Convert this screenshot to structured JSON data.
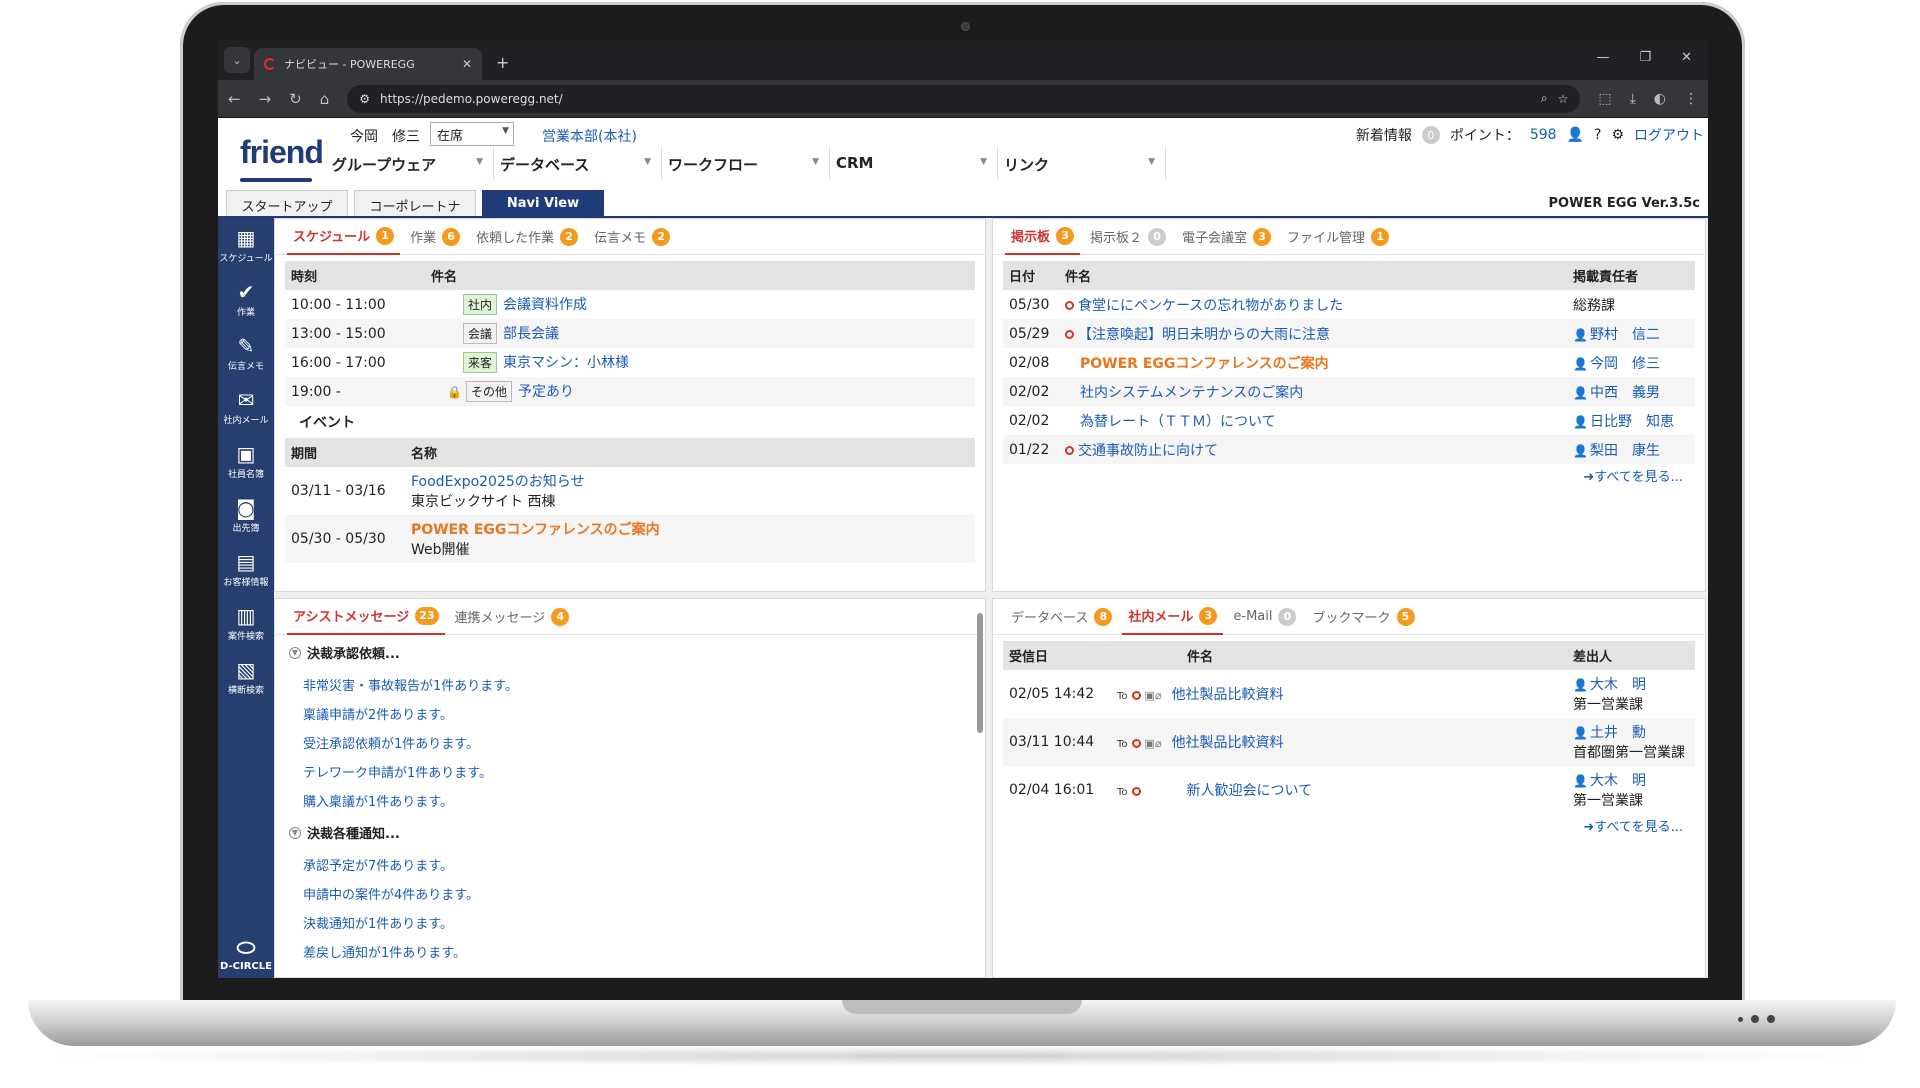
{
  "browser": {
    "tab_title": "ナビビュー - POWEREGG",
    "url": "https://pedemo.poweregg.net/"
  },
  "app": {
    "logo": "friend",
    "user": "今岡　修三",
    "status": "在席",
    "dept": "営業本部(本社)",
    "new_info_label": "新着情報",
    "new_info_count": "0",
    "points_label": "ポイント：",
    "points": "598",
    "logout": "ログアウト",
    "version": "POWER EGG Ver.3.5c",
    "menu": [
      "グループウェア",
      "データベース",
      "ワークフロー",
      "CRM",
      "リンク"
    ],
    "navtabs": [
      "スタートアップナビ",
      "コーポレートナビ",
      "Navi View"
    ]
  },
  "leftnav": [
    {
      "label": "スケジュール",
      "icon": "calendar-icon"
    },
    {
      "label": "作業",
      "icon": "check-icon"
    },
    {
      "label": "伝言メモ",
      "icon": "memo-icon"
    },
    {
      "label": "社内メール",
      "icon": "mail-icon"
    },
    {
      "label": "社員名簿",
      "icon": "person-icon"
    },
    {
      "label": "出先簿",
      "icon": "location-icon"
    },
    {
      "label": "お客様情報",
      "icon": "customer-icon"
    },
    {
      "label": "案件検索",
      "icon": "document-icon"
    },
    {
      "label": "横断検索",
      "icon": "cross-search-icon"
    }
  ],
  "leftnav_footer": "D-CIRCLE",
  "schedule": {
    "tabs": [
      {
        "label": "スケジュール",
        "count": "1"
      },
      {
        "label": "作業",
        "count": "6"
      },
      {
        "label": "依頼した作業",
        "count": "2"
      },
      {
        "label": "伝言メモ",
        "count": "2"
      }
    ],
    "headers": [
      "時刻",
      "件名"
    ],
    "rows": [
      {
        "time": "10:00 - 11:00",
        "cat": "社内",
        "title": "会議資料作成"
      },
      {
        "time": "13:00 - 15:00",
        "cat": "会議",
        "title": "部長会議"
      },
      {
        "time": "16:00 - 17:00",
        "cat": "来客",
        "title": "東京マシン：小林様"
      },
      {
        "time": "19:00 -",
        "cat": "その他",
        "title": "予定あり"
      }
    ],
    "event_heading": "イベント",
    "event_headers": [
      "期間",
      "名称"
    ],
    "events": [
      {
        "period": "03/11 - 03/16",
        "name": "FoodExpo2025のお知らせ",
        "place": "東京ビックサイト 西棟"
      },
      {
        "period": "05/30 - 05/30",
        "name": "POWER EGGコンファレンスのご案内",
        "place": "Web開催"
      }
    ]
  },
  "board": {
    "tabs": [
      {
        "label": "掲示板",
        "count": "3"
      },
      {
        "label": "掲示板２",
        "count": "0"
      },
      {
        "label": "電子会議室",
        "count": "3"
      },
      {
        "label": "ファイル管理",
        "count": "1"
      }
    ],
    "headers": [
      "日付",
      "件名",
      "掲載責任者"
    ],
    "rows": [
      {
        "date": "05/30",
        "title": "食堂ににペンケースの忘れ物がありました",
        "owner": "総務課"
      },
      {
        "date": "05/29",
        "title": "【注意喚起】明日未明からの大雨に注意",
        "owner": "野村　信二"
      },
      {
        "date": "02/08",
        "title": "POWER EGGコンファレンスのご案内",
        "owner": "今岡　修三"
      },
      {
        "date": "02/02",
        "title": "社内システムメンテナンスのご案内",
        "owner": "中西　義男"
      },
      {
        "date": "02/02",
        "title": "為替レート（ＴＴＭ）について",
        "owner": "日比野　知恵"
      },
      {
        "date": "01/22",
        "title": "交通事故防止に向けて",
        "owner": "梨田　康生"
      }
    ],
    "see_all": "➜すべてを見る..."
  },
  "assist": {
    "tabs": [
      {
        "label": "アシストメッセージ",
        "count": "23"
      },
      {
        "label": "連携メッセージ",
        "count": "4"
      }
    ],
    "group1": "決裁承認依頼...",
    "items1": [
      "非常災害・事故報告が1件あります。",
      "稟議申請が2件あります。",
      "受注承認依頼が1件あります。",
      "テレワーク申請が1件あります。",
      "購入稟議が1件あります。"
    ],
    "group2": "決裁各種通知...",
    "items2": [
      "承認予定が7件あります。",
      "申請中の案件が4件あります。",
      "決裁通知が1件あります。",
      "差戻し通知が1件あります。"
    ]
  },
  "mail": {
    "tabs": [
      {
        "label": "データベース",
        "count": "8"
      },
      {
        "label": "社内メール",
        "count": "3"
      },
      {
        "label": "e-Mail",
        "count": "0"
      },
      {
        "label": "ブックマーク",
        "count": "5"
      }
    ],
    "headers": [
      "受信日",
      "件名",
      "差出人"
    ],
    "rows": [
      {
        "date": "02/05 14:42",
        "to": "To",
        "title": "他社製品比較資料",
        "sender": "大木　明",
        "dept": "第一営業課"
      },
      {
        "date": "03/11 10:44",
        "to": "To",
        "title": "他社製品比較資料",
        "sender": "土井　勳",
        "dept": "首都圏第一営業課"
      },
      {
        "date": "02/04 16:01",
        "to": "To",
        "title": "新人歓迎会について",
        "sender": "大木　明",
        "dept": "第一営業課"
      }
    ],
    "see_all": "➜すべてを見る..."
  }
}
